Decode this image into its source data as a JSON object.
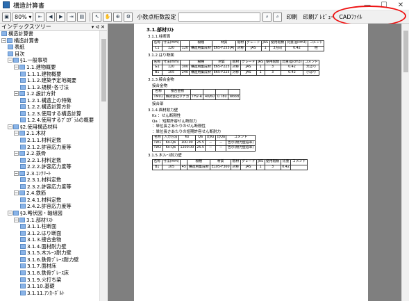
{
  "window": {
    "title": "構造計算書",
    "minimize": "—",
    "maximize": "☐",
    "close": "✕"
  },
  "toolbar": {
    "zoom": "80%",
    "decimal_label": "小数点桁数設定",
    "print": "印刷",
    "print_preview": "印刷ﾌﾟﾚﾋﾞｭｰ",
    "cad_file": "CADﾌｧｲﾙ",
    "find_icons": "find-icon"
  },
  "tree": {
    "header": "インデックスツリー",
    "header_ctl": "▾ ᐊ ✕",
    "items": [
      {
        "label": "構造計算書",
        "indent": 0,
        "exp": ""
      },
      {
        "label": "構造計算書",
        "indent": 0,
        "exp": "−"
      },
      {
        "label": "表紙",
        "indent": 1,
        "exp": ""
      },
      {
        "label": "目次",
        "indent": 1,
        "exp": ""
      },
      {
        "label": "§1.一般事項",
        "indent": 1,
        "exp": "−"
      },
      {
        "label": "1.1.建物概要",
        "indent": 2,
        "exp": "−"
      },
      {
        "label": "1.1.1.建物概要",
        "indent": 3,
        "exp": ""
      },
      {
        "label": "1.1.2.建築予定地概要",
        "indent": 3,
        "exp": ""
      },
      {
        "label": "1.1.3.規模･各寸法",
        "indent": 3,
        "exp": ""
      },
      {
        "label": "1.2.設計方針",
        "indent": 2,
        "exp": "−"
      },
      {
        "label": "1.2.1.構造上の特徴",
        "indent": 3,
        "exp": ""
      },
      {
        "label": "1.2.2.構造計算方針",
        "indent": 3,
        "exp": ""
      },
      {
        "label": "1.2.3.使用する構造計算",
        "indent": 3,
        "exp": ""
      },
      {
        "label": "1.2.4.使用するﾌﾟﾛｸﾞﾗﾑの概要",
        "indent": 3,
        "exp": ""
      },
      {
        "label": "§2.使用構造材料",
        "indent": 1,
        "exp": "−"
      },
      {
        "label": "2.1.木材",
        "indent": 2,
        "exp": "−"
      },
      {
        "label": "2.1.1.材料定数",
        "indent": 3,
        "exp": ""
      },
      {
        "label": "2.1.2.許容応力度等",
        "indent": 3,
        "exp": ""
      },
      {
        "label": "2.2.鉄骨",
        "indent": 2,
        "exp": "−"
      },
      {
        "label": "2.2.1.材料定数",
        "indent": 3,
        "exp": ""
      },
      {
        "label": "2.2.2.許容応力度等",
        "indent": 3,
        "exp": ""
      },
      {
        "label": "2.3.ｺﾝｸﾘｰﾄ",
        "indent": 2,
        "exp": "−"
      },
      {
        "label": "2.3.1.材料定数",
        "indent": 3,
        "exp": ""
      },
      {
        "label": "2.3.2.許容応力度等",
        "indent": 3,
        "exp": ""
      },
      {
        "label": "2.4.鉄筋",
        "indent": 2,
        "exp": "−"
      },
      {
        "label": "2.4.1.材料定数",
        "indent": 3,
        "exp": ""
      },
      {
        "label": "2.4.2.許容応力度等",
        "indent": 3,
        "exp": ""
      },
      {
        "label": "§3.略伏図・軸組図",
        "indent": 1,
        "exp": "−"
      },
      {
        "label": "3.1.部材ﾘｽﾄ",
        "indent": 2,
        "exp": "−"
      },
      {
        "label": "3.1.1.柱断面",
        "indent": 3,
        "exp": ""
      },
      {
        "label": "3.1.2.はり断面",
        "indent": 3,
        "exp": ""
      },
      {
        "label": "3.1.3.接合金物",
        "indent": 3,
        "exp": ""
      },
      {
        "label": "3.1.4.面材耐力壁",
        "indent": 3,
        "exp": ""
      },
      {
        "label": "3.1.5.木ﾌﾚｰｽ耐力壁",
        "indent": 3,
        "exp": ""
      },
      {
        "label": "3.1.6.鉄骨ﾌﾞﾚｰｽ耐力壁",
        "indent": 3,
        "exp": ""
      },
      {
        "label": "3.1.7.面材床",
        "indent": 3,
        "exp": ""
      },
      {
        "label": "3.1.8.鉄骨ﾌﾞﾚｰｽ床",
        "indent": 3,
        "exp": ""
      },
      {
        "label": "3.1.9.火打ち梁",
        "indent": 3,
        "exp": ""
      },
      {
        "label": "3.1.10.基礎",
        "indent": 3,
        "exp": ""
      },
      {
        "label": "3.1.11.ｱﾝｶｰﾎﾞﾙﾄ",
        "indent": 3,
        "exp": ""
      }
    ]
  },
  "doc": {
    "title": "3.1.部材ﾘｽﾄ",
    "s1": "3.1.1.柱断面",
    "s2": "3.1.2.はり断面",
    "s3": "3.1.3.接合金物",
    "s3a": "接合金物",
    "s3b": "接合部",
    "s4": "3.1.4.面材耐力壁",
    "s4a": "Ks  ：せん断剛性",
    "s4b": "Qa  ：短期許容せん断耐力",
    "s4c": "  ：単位長さあたりのせん断剛性",
    "s4d": "  ：単位長さあたりの短期許容せん断耐力",
    "s5": "3.1.5.木ﾌﾚｰｽ耐力壁",
    "t1": [
      [
        "名称",
        "寸法(mm)",
        "",
        "樹種",
        "材質",
        "階材",
        "グレード",
        "JAS",
        "使用階数",
        "比重(g/cm3)",
        "コメント"
      ],
      [
        "C1",
        "120",
        "120",
        "構造用集成材",
        "E65-F255(A)",
        "対称",
        "JAS",
        "1",
        "3方向",
        "0.42",
        "柱"
      ]
    ],
    "t2": [
      [
        "名称",
        "寸法(mm)",
        "",
        "樹種",
        "材質",
        "階材",
        "グレード",
        "JAS",
        "使用階数",
        "比重(g/cm3)",
        "コメント"
      ],
      [
        "G1",
        "120",
        "300",
        "構造用集成材",
        "E65-F225",
        "対称",
        "JAS",
        "1",
        "3",
        "0.42",
        "大ばり"
      ],
      [
        "B1",
        "105",
        "240",
        "構造用集成材",
        "E65-F225",
        "対称",
        "JAS",
        "1",
        "3",
        "0.42",
        "小ばり"
      ]
    ],
    "t3": [
      [
        "名称",
        "接合金物",
        "",
        "",
        "",
        ""
      ],
      [
        "TM01",
        "株式会社タナカ",
        "TH2-R",
        "40/60",
        "0.780",
        "Wood"
      ]
    ],
    "t4": [
      [
        "名称",
        "入力方法",
        "Ks",
        "Qa",
        "比Ks",
        "比Qa",
        "コメント"
      ],
      [
        "TW1",
        "Ks-Qa",
        "100.00",
        "25.5",
        "－",
        "－",
        "告示(耐力壁倍率)"
      ],
      [
        "TW2",
        "Ks-Qa",
        "1200.00",
        "25.5",
        "－",
        "－",
        "告示(耐力壁倍率)"
      ]
    ],
    "t5": [
      [
        "名称",
        "寸法(mm)",
        "",
        "樹種",
        "材質",
        "階材",
        "グレード",
        "JAS",
        "使用階数",
        "比重",
        "コメント"
      ],
      [
        "B1",
        "105",
        "45",
        "構造用集成材",
        "E105-F300",
        "対称",
        "JAS",
        "1",
        "3",
        "0.42",
        ""
      ]
    ]
  }
}
